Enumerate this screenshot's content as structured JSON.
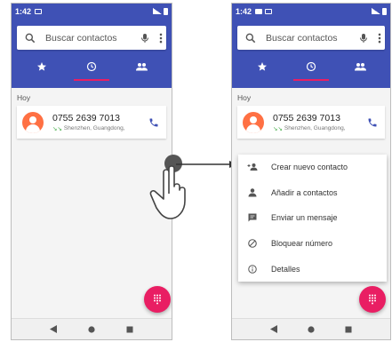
{
  "status_bar": {
    "time": "1:42"
  },
  "search": {
    "placeholder": "Buscar contactos"
  },
  "tabs": [
    {
      "name": "favorites",
      "icon": "star-icon"
    },
    {
      "name": "recents",
      "icon": "clock-icon",
      "active": true
    },
    {
      "name": "contacts",
      "icon": "people-icon"
    }
  ],
  "section_header": "Hoy",
  "call_log": {
    "number": "0755 2639 7013",
    "location": "Shenzhen, Guangdong,"
  },
  "context_menu": {
    "items": [
      {
        "label": "Crear nuevo contacto",
        "icon": "add-person-icon"
      },
      {
        "label": "Añadir a contactos",
        "icon": "person-icon"
      },
      {
        "label": "Enviar un mensaje",
        "icon": "message-icon"
      },
      {
        "label": "Bloquear número",
        "icon": "block-icon"
      },
      {
        "label": "Detalles",
        "icon": "info-icon"
      }
    ]
  },
  "colors": {
    "primary": "#3f51b5",
    "accent": "#e91e63",
    "avatar": "#ff7043",
    "incoming_call": "#4caf50"
  }
}
